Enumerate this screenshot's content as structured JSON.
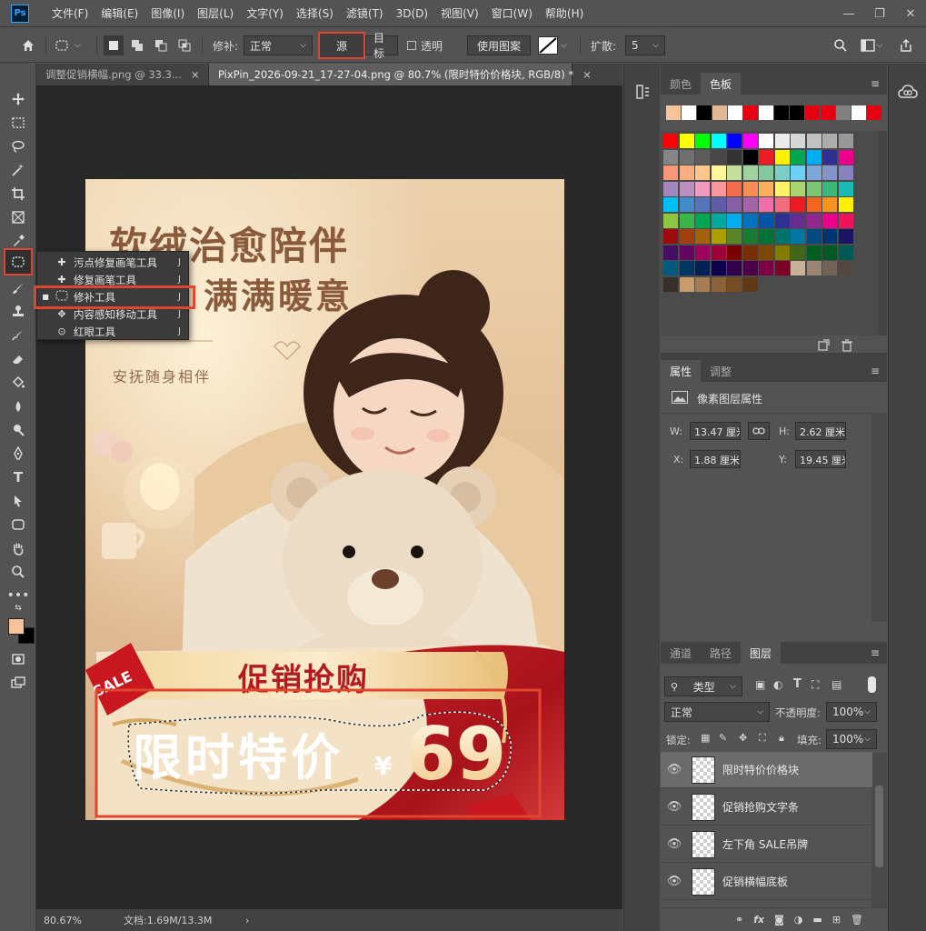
{
  "app": {
    "logo": "Ps"
  },
  "menu": [
    "文件(F)",
    "编辑(E)",
    "图像(I)",
    "图层(L)",
    "文字(Y)",
    "选择(S)",
    "滤镜(T)",
    "3D(D)",
    "视图(V)",
    "窗口(W)",
    "帮助(H)"
  ],
  "options": {
    "patch_label": "修补:",
    "patch_mode": "正常",
    "source_label": "源",
    "target_label": "目标",
    "transparent_label": "透明",
    "use_pattern_label": "使用图案",
    "diffusion_label": "扩散:",
    "diffusion_value": "5"
  },
  "tabs": [
    {
      "label": "调整促销横幅.png @ 33.3...",
      "close": "×"
    },
    {
      "label": "PixPin_2026-09-21_17-27-04.png @ 80.7% (限时特价价格块, RGB/8) *",
      "close": "×"
    }
  ],
  "flyout": {
    "items": [
      {
        "label": "污点修复画笔工具",
        "key": "J",
        "icon": "spot-healing-brush-icon"
      },
      {
        "label": "修复画笔工具",
        "key": "J",
        "icon": "healing-brush-icon"
      },
      {
        "label": "修补工具",
        "key": "J",
        "icon": "patch-icon"
      },
      {
        "label": "内容感知移动工具",
        "key": "J",
        "icon": "content-aware-move-icon"
      },
      {
        "label": "红眼工具",
        "key": "J",
        "icon": "red-eye-icon"
      }
    ]
  },
  "artwork": {
    "headline1": "软绒治愈陪伴",
    "headline2": "满满暖意",
    "subline": "安抚随身相伴",
    "sale_tag": "SALE",
    "banner_title": "促销抢购",
    "price_label": "限时特价",
    "currency": "¥",
    "price": "69"
  },
  "status": {
    "zoom": "80.67%",
    "doc": "文档:1.69M/13.3M",
    "arrow": "›"
  },
  "swatch_panel": {
    "tabs": [
      "颜色",
      "色板"
    ],
    "recent": [
      "#f6c39a",
      "#ffffff",
      "#000000",
      "#e0b894",
      "#ffffff",
      "#e60012",
      "#ffffff",
      "#000000",
      "#000000",
      "#e60012",
      "#e60012",
      "#808080",
      "#ffffff",
      "#e60012"
    ],
    "grid": [
      [
        "#ff0000",
        "#ffff00",
        "#00ff00",
        "#00ffff",
        "#0000ff",
        "#ff00ff",
        "#ffffff",
        "#ebebeb",
        "#d6d6d6",
        "#c2c2c2",
        "#adadad",
        "#999999"
      ],
      [
        "#858585",
        "#707070",
        "#5c5c5c",
        "#474747",
        "#333333",
        "#000000",
        "#ee1d24",
        "#fff100",
        "#00a650",
        "#00aeef",
        "#2e3192",
        "#ec008c"
      ],
      [
        "#f7977a",
        "#f9ad81",
        "#fdc68a",
        "#fff79a",
        "#c4df9b",
        "#a2d39c",
        "#82ca9d",
        "#7bcdc8",
        "#6ecff6",
        "#7ea7d8",
        "#8493ca",
        "#8882be"
      ],
      [
        "#a187be",
        "#bc8dbf",
        "#f49ac2",
        "#f6989d",
        "#f26c4f",
        "#f68e55",
        "#fbaf5c",
        "#fff467",
        "#acd372",
        "#7cc576",
        "#3bb878",
        "#1abbb4"
      ],
      [
        "#00bff3",
        "#438ccb",
        "#5574b9",
        "#605ca8",
        "#855fa8",
        "#a763a8",
        "#f06ea9",
        "#f26d7d",
        "#ed1c24",
        "#f26522",
        "#f7941d",
        "#fff200"
      ],
      [
        "#8dc63f",
        "#39b54a",
        "#00a651",
        "#00a99d",
        "#00aeef",
        "#0072bc",
        "#0054a6",
        "#2e3192",
        "#662d91",
        "#92278f",
        "#ec008c",
        "#ed145b"
      ],
      [
        "#9e0b0f",
        "#a0410d",
        "#a3620a",
        "#aba000",
        "#598527",
        "#197b30",
        "#007236",
        "#00746b",
        "#0076a3",
        "#004a80",
        "#003471",
        "#1b1464"
      ],
      [
        "#440e62",
        "#630460",
        "#9e005d",
        "#9e0039",
        "#790000",
        "#7b2e00",
        "#7d4900",
        "#827b00",
        "#406618",
        "#005e20",
        "#005826",
        "#005952"
      ],
      [
        "#005b7f",
        "#003663",
        "#002157",
        "#0d004c",
        "#32004b",
        "#4b0049",
        "#7b0046",
        "#7a0026",
        "#c7b299",
        "#998675",
        "#736357",
        "#534741"
      ],
      [
        "#37302a",
        "#c69c6d",
        "#a67c52",
        "#8c6239",
        "#754c24",
        "#603913"
      ]
    ]
  },
  "properties": {
    "tabs": [
      "属性",
      "调整"
    ],
    "title": "像素图层属性",
    "w_label": "W:",
    "w": "13.47 厘米",
    "h_label": "H:",
    "h": "2.62 厘米",
    "x_label": "X:",
    "x": "1.88 厘米",
    "y_label": "Y:",
    "y": "19.45 厘米"
  },
  "layers_panel": {
    "tabs": [
      "通道",
      "路径",
      "图层"
    ],
    "filter": "类型",
    "blend": "正常",
    "opacity_label": "不透明度:",
    "opacity": "100%",
    "lock_label": "锁定:",
    "fill_label": "填充:",
    "fill": "100%",
    "layers": [
      {
        "name": "限时特价价格块",
        "selected": true
      },
      {
        "name": "促销抢购文字条",
        "selected": false
      },
      {
        "name": "左下角 SALE吊牌",
        "selected": false
      },
      {
        "name": "促销横幅底板",
        "selected": false
      }
    ]
  },
  "colors": {
    "accent": "#e0452d",
    "foreground": "#f6c39a",
    "background": "#000000"
  }
}
